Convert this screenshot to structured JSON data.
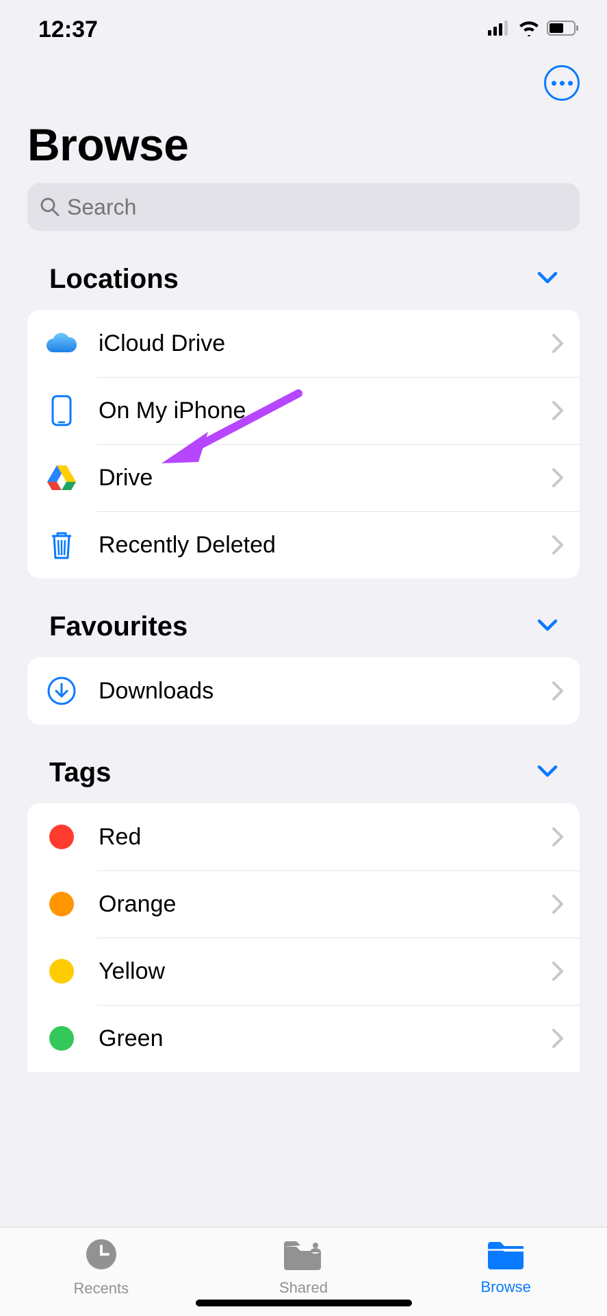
{
  "statusbar": {
    "time": "12:37"
  },
  "header": {
    "title": "Browse"
  },
  "search": {
    "placeholder": "Search"
  },
  "sections": {
    "locations": {
      "title": "Locations",
      "items": [
        {
          "label": "iCloud Drive",
          "icon": "icloud"
        },
        {
          "label": "On My iPhone",
          "icon": "iphone"
        },
        {
          "label": "Drive",
          "icon": "gdrive"
        },
        {
          "label": "Recently Deleted",
          "icon": "trash"
        }
      ]
    },
    "favourites": {
      "title": "Favourites",
      "items": [
        {
          "label": "Downloads",
          "icon": "download"
        }
      ]
    },
    "tags": {
      "title": "Tags",
      "items": [
        {
          "label": "Red",
          "color": "#ff3b30"
        },
        {
          "label": "Orange",
          "color": "#ff9500"
        },
        {
          "label": "Yellow",
          "color": "#ffcc00"
        },
        {
          "label": "Green",
          "color": "#34c759"
        }
      ]
    }
  },
  "tabs": [
    {
      "label": "Recents",
      "active": false
    },
    {
      "label": "Shared",
      "active": false
    },
    {
      "label": "Browse",
      "active": true
    }
  ],
  "annotation": {
    "arrow_color": "#b646ff"
  }
}
